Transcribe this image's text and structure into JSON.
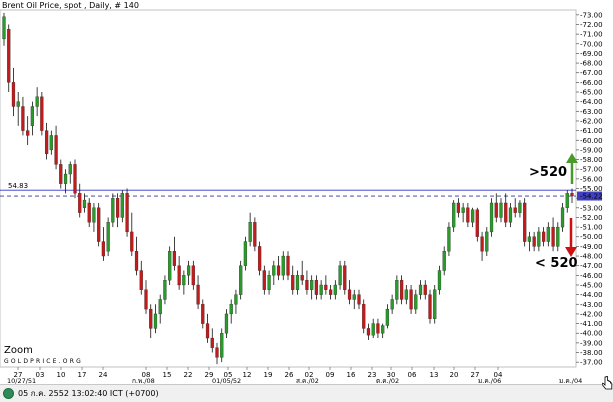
{
  "chart_data": {
    "type": "candlestick",
    "title": "Brent Oil Price, spot , Daily, # 140",
    "ylim": [
      36.5,
      73.5
    ],
    "y_ticks": [
      37,
      38,
      39,
      40,
      41,
      42,
      43,
      44,
      45,
      46,
      47,
      48,
      49,
      50,
      51,
      52,
      53,
      54,
      55,
      56,
      57,
      58,
      59,
      60,
      61,
      62,
      63,
      64,
      65,
      66,
      67,
      68,
      69,
      70,
      71,
      72,
      73
    ],
    "y_tick_format": "-{v}.00",
    "x_ticks_top": [
      "27",
      "03",
      "10",
      "17",
      "24",
      "08",
      "15",
      "22",
      "29",
      "05",
      "12",
      "19",
      "26",
      "02",
      "09",
      "16",
      "23",
      "30",
      "06",
      "13",
      "20",
      "27",
      "04"
    ],
    "x_ticks_bottom": [
      "10/27/51",
      "ก.พ./08",
      "01/05/52",
      "ส.ค./02",
      "ต.ค./02",
      "ม.ค./06",
      "ม.ค./04"
    ],
    "horizontal_lines": [
      {
        "value": 54.83,
        "label": "54.83",
        "style": "solid",
        "color": "#3333cc"
      },
      {
        "value": 54.22,
        "label": "54.22",
        "style": "dashed",
        "color": "#333399"
      }
    ],
    "last_value_badge": "54.22",
    "annotations": [
      {
        "text": ">520",
        "arrow": "up",
        "color": "#4a9a2a"
      },
      {
        "text": "< 520",
        "arrow": "down",
        "color": "#cc1111"
      }
    ],
    "watermark": "GOLDPRICE.ORG",
    "zoom_label": "Zoom",
    "up_color": "#2a9a2a",
    "down_color": "#c21b1b",
    "candles": [
      {
        "o": 70.5,
        "h": 73.2,
        "l": 69.8,
        "c": 72.8
      },
      {
        "o": 71.5,
        "h": 72.0,
        "l": 65.0,
        "c": 66.0
      },
      {
        "o": 66.0,
        "h": 67.5,
        "l": 62.5,
        "c": 63.5
      },
      {
        "o": 63.5,
        "h": 65.0,
        "l": 61.5,
        "c": 64.0
      },
      {
        "o": 63.5,
        "h": 64.5,
        "l": 60.5,
        "c": 61.0
      },
      {
        "o": 61.0,
        "h": 62.5,
        "l": 59.5,
        "c": 60.5
      },
      {
        "o": 61.5,
        "h": 64.0,
        "l": 60.5,
        "c": 63.5
      },
      {
        "o": 63.5,
        "h": 65.5,
        "l": 62.5,
        "c": 64.5
      },
      {
        "o": 64.5,
        "h": 65.0,
        "l": 60.5,
        "c": 61.0
      },
      {
        "o": 61.0,
        "h": 61.8,
        "l": 58.0,
        "c": 58.6
      },
      {
        "o": 59.0,
        "h": 61.0,
        "l": 58.5,
        "c": 60.5
      },
      {
        "o": 60.5,
        "h": 61.5,
        "l": 57.0,
        "c": 57.5
      },
      {
        "o": 57.5,
        "h": 58.0,
        "l": 55.0,
        "c": 55.5
      },
      {
        "o": 55.5,
        "h": 57.0,
        "l": 54.5,
        "c": 56.5
      },
      {
        "o": 56.5,
        "h": 57.8,
        "l": 55.5,
        "c": 57.5
      },
      {
        "o": 57.5,
        "h": 58.0,
        "l": 54.0,
        "c": 54.5
      },
      {
        "o": 54.5,
        "h": 55.5,
        "l": 52.0,
        "c": 52.5
      },
      {
        "o": 53.0,
        "h": 54.5,
        "l": 52.5,
        "c": 53.8
      },
      {
        "o": 53.5,
        "h": 54.0,
        "l": 51.0,
        "c": 51.5
      },
      {
        "o": 51.5,
        "h": 53.5,
        "l": 50.5,
        "c": 53.0
      },
      {
        "o": 53.0,
        "h": 53.5,
        "l": 49.0,
        "c": 49.5
      },
      {
        "o": 49.5,
        "h": 51.0,
        "l": 47.5,
        "c": 48.0
      },
      {
        "o": 48.5,
        "h": 52.0,
        "l": 48.0,
        "c": 51.5
      },
      {
        "o": 51.5,
        "h": 54.5,
        "l": 51.0,
        "c": 54.0
      },
      {
        "o": 54.0,
        "h": 54.5,
        "l": 51.0,
        "c": 52.0
      },
      {
        "o": 52.0,
        "h": 54.8,
        "l": 51.5,
        "c": 54.5
      },
      {
        "o": 54.5,
        "h": 55.0,
        "l": 50.0,
        "c": 50.5
      },
      {
        "o": 50.5,
        "h": 52.5,
        "l": 48.0,
        "c": 48.5
      },
      {
        "o": 48.5,
        "h": 50.0,
        "l": 46.0,
        "c": 46.5
      },
      {
        "o": 46.5,
        "h": 47.5,
        "l": 44.0,
        "c": 44.5
      },
      {
        "o": 44.5,
        "h": 45.5,
        "l": 42.0,
        "c": 42.5
      },
      {
        "o": 42.5,
        "h": 43.0,
        "l": 39.5,
        "c": 40.5
      },
      {
        "o": 40.5,
        "h": 43.0,
        "l": 40.0,
        "c": 42.0
      },
      {
        "o": 42.0,
        "h": 44.0,
        "l": 41.0,
        "c": 43.5
      },
      {
        "o": 43.5,
        "h": 46.0,
        "l": 43.0,
        "c": 45.5
      },
      {
        "o": 45.5,
        "h": 49.0,
        "l": 45.0,
        "c": 48.5
      },
      {
        "o": 48.5,
        "h": 50.0,
        "l": 46.5,
        "c": 47.0
      },
      {
        "o": 47.0,
        "h": 48.0,
        "l": 44.5,
        "c": 45.0
      },
      {
        "o": 45.0,
        "h": 46.5,
        "l": 44.0,
        "c": 46.0
      },
      {
        "o": 46.0,
        "h": 47.5,
        "l": 45.0,
        "c": 47.0
      },
      {
        "o": 47.0,
        "h": 47.5,
        "l": 44.5,
        "c": 45.0
      },
      {
        "o": 45.0,
        "h": 46.0,
        "l": 42.5,
        "c": 43.0
      },
      {
        "o": 43.0,
        "h": 43.5,
        "l": 40.5,
        "c": 41.0
      },
      {
        "o": 41.0,
        "h": 42.0,
        "l": 39.0,
        "c": 39.5
      },
      {
        "o": 39.5,
        "h": 40.5,
        "l": 38.0,
        "c": 38.5
      },
      {
        "o": 38.5,
        "h": 39.0,
        "l": 36.8,
        "c": 37.5
      },
      {
        "o": 37.5,
        "h": 40.5,
        "l": 37.0,
        "c": 40.0
      },
      {
        "o": 40.0,
        "h": 42.5,
        "l": 39.5,
        "c": 42.0
      },
      {
        "o": 42.0,
        "h": 43.5,
        "l": 41.0,
        "c": 43.0
      },
      {
        "o": 43.0,
        "h": 44.5,
        "l": 42.0,
        "c": 44.0
      },
      {
        "o": 44.0,
        "h": 47.5,
        "l": 43.5,
        "c": 47.0
      },
      {
        "o": 47.0,
        "h": 50.0,
        "l": 46.5,
        "c": 49.5
      },
      {
        "o": 49.5,
        "h": 52.5,
        "l": 49.0,
        "c": 51.5
      },
      {
        "o": 51.5,
        "h": 52.0,
        "l": 48.5,
        "c": 49.0
      },
      {
        "o": 49.0,
        "h": 49.5,
        "l": 46.0,
        "c": 46.5
      },
      {
        "o": 46.5,
        "h": 47.0,
        "l": 44.0,
        "c": 44.5
      },
      {
        "o": 44.5,
        "h": 46.5,
        "l": 44.0,
        "c": 46.0
      },
      {
        "o": 46.0,
        "h": 47.5,
        "l": 45.0,
        "c": 47.0
      },
      {
        "o": 47.0,
        "h": 48.0,
        "l": 45.5,
        "c": 46.0
      },
      {
        "o": 46.0,
        "h": 48.5,
        "l": 45.5,
        "c": 48.0
      },
      {
        "o": 48.0,
        "h": 48.5,
        "l": 45.5,
        "c": 46.0
      },
      {
        "o": 46.0,
        "h": 47.0,
        "l": 44.0,
        "c": 44.5
      },
      {
        "o": 44.5,
        "h": 46.5,
        "l": 44.0,
        "c": 46.0
      },
      {
        "o": 46.0,
        "h": 47.5,
        "l": 45.0,
        "c": 45.5
      },
      {
        "o": 45.5,
        "h": 46.5,
        "l": 44.0,
        "c": 44.5
      },
      {
        "o": 44.5,
        "h": 46.0,
        "l": 43.5,
        "c": 45.5
      },
      {
        "o": 45.5,
        "h": 46.0,
        "l": 43.5,
        "c": 44.0
      },
      {
        "o": 44.0,
        "h": 45.5,
        "l": 43.5,
        "c": 45.0
      },
      {
        "o": 45.0,
        "h": 46.0,
        "l": 44.0,
        "c": 44.5
      },
      {
        "o": 44.5,
        "h": 45.0,
        "l": 43.5,
        "c": 44.0
      },
      {
        "o": 44.0,
        "h": 45.5,
        "l": 43.5,
        "c": 45.0
      },
      {
        "o": 45.0,
        "h": 47.5,
        "l": 44.5,
        "c": 47.0
      },
      {
        "o": 47.0,
        "h": 47.5,
        "l": 44.0,
        "c": 44.5
      },
      {
        "o": 44.5,
        "h": 45.5,
        "l": 43.0,
        "c": 43.5
      },
      {
        "o": 43.5,
        "h": 44.5,
        "l": 42.5,
        "c": 44.0
      },
      {
        "o": 44.0,
        "h": 44.5,
        "l": 42.5,
        "c": 43.0
      },
      {
        "o": 43.0,
        "h": 43.5,
        "l": 40.0,
        "c": 40.5
      },
      {
        "o": 40.5,
        "h": 41.0,
        "l": 39.3,
        "c": 39.8
      },
      {
        "o": 39.8,
        "h": 41.5,
        "l": 39.5,
        "c": 41.0
      },
      {
        "o": 41.0,
        "h": 41.5,
        "l": 39.5,
        "c": 40.0
      },
      {
        "o": 40.0,
        "h": 41.0,
        "l": 39.5,
        "c": 40.8
      },
      {
        "o": 40.8,
        "h": 43.0,
        "l": 40.5,
        "c": 42.5
      },
      {
        "o": 42.5,
        "h": 44.0,
        "l": 42.0,
        "c": 43.5
      },
      {
        "o": 43.5,
        "h": 46.0,
        "l": 43.0,
        "c": 45.5
      },
      {
        "o": 45.5,
        "h": 46.0,
        "l": 43.0,
        "c": 43.5
      },
      {
        "o": 43.5,
        "h": 45.0,
        "l": 43.0,
        "c": 44.5
      },
      {
        "o": 44.5,
        "h": 45.0,
        "l": 42.0,
        "c": 42.5
      },
      {
        "o": 42.5,
        "h": 44.5,
        "l": 42.0,
        "c": 44.0
      },
      {
        "o": 44.0,
        "h": 45.5,
        "l": 43.5,
        "c": 45.0
      },
      {
        "o": 45.0,
        "h": 45.5,
        "l": 43.5,
        "c": 44.0
      },
      {
        "o": 44.0,
        "h": 44.5,
        "l": 41.0,
        "c": 41.5
      },
      {
        "o": 41.5,
        "h": 45.0,
        "l": 41.0,
        "c": 44.5
      },
      {
        "o": 44.5,
        "h": 47.0,
        "l": 44.0,
        "c": 46.5
      },
      {
        "o": 46.5,
        "h": 49.0,
        "l": 46.0,
        "c": 48.5
      },
      {
        "o": 48.5,
        "h": 51.5,
        "l": 48.0,
        "c": 51.0
      },
      {
        "o": 51.0,
        "h": 53.8,
        "l": 50.5,
        "c": 53.5
      },
      {
        "o": 53.5,
        "h": 54.0,
        "l": 52.0,
        "c": 52.5
      },
      {
        "o": 52.5,
        "h": 53.5,
        "l": 51.5,
        "c": 53.0
      },
      {
        "o": 53.0,
        "h": 53.5,
        "l": 51.0,
        "c": 51.5
      },
      {
        "o": 51.5,
        "h": 53.0,
        "l": 51.0,
        "c": 52.8
      },
      {
        "o": 52.8,
        "h": 53.0,
        "l": 49.5,
        "c": 50.0
      },
      {
        "o": 50.0,
        "h": 50.5,
        "l": 47.5,
        "c": 48.5
      },
      {
        "o": 48.5,
        "h": 51.0,
        "l": 48.0,
        "c": 50.5
      },
      {
        "o": 50.5,
        "h": 54.0,
        "l": 50.0,
        "c": 53.5
      },
      {
        "o": 53.5,
        "h": 54.5,
        "l": 51.5,
        "c": 52.0
      },
      {
        "o": 52.0,
        "h": 54.0,
        "l": 51.5,
        "c": 53.5
      },
      {
        "o": 53.5,
        "h": 54.5,
        "l": 51.0,
        "c": 51.5
      },
      {
        "o": 51.5,
        "h": 53.5,
        "l": 51.0,
        "c": 53.0
      },
      {
        "o": 53.0,
        "h": 54.0,
        "l": 52.0,
        "c": 52.5
      },
      {
        "o": 52.5,
        "h": 53.8,
        "l": 52.0,
        "c": 53.5
      },
      {
        "o": 53.5,
        "h": 54.0,
        "l": 49.0,
        "c": 49.5
      },
      {
        "o": 49.5,
        "h": 50.5,
        "l": 48.5,
        "c": 50.0
      },
      {
        "o": 50.0,
        "h": 50.5,
        "l": 48.5,
        "c": 49.0
      },
      {
        "o": 49.0,
        "h": 51.0,
        "l": 48.5,
        "c": 50.5
      },
      {
        "o": 50.5,
        "h": 51.0,
        "l": 49.0,
        "c": 49.5
      },
      {
        "o": 49.5,
        "h": 51.5,
        "l": 49.0,
        "c": 51.0
      },
      {
        "o": 51.0,
        "h": 52.0,
        "l": 48.5,
        "c": 49.0
      },
      {
        "o": 49.0,
        "h": 51.5,
        "l": 48.5,
        "c": 51.0
      },
      {
        "o": 51.0,
        "h": 53.5,
        "l": 50.5,
        "c": 53.0
      },
      {
        "o": 53.0,
        "h": 54.8,
        "l": 52.5,
        "c": 54.5
      },
      {
        "o": 54.5,
        "h": 55.0,
        "l": 53.5,
        "c": 54.22
      }
    ]
  },
  "status_bar": {
    "text": "05 ก.ค. 2552 13:02:40  ICT (+0700)"
  }
}
